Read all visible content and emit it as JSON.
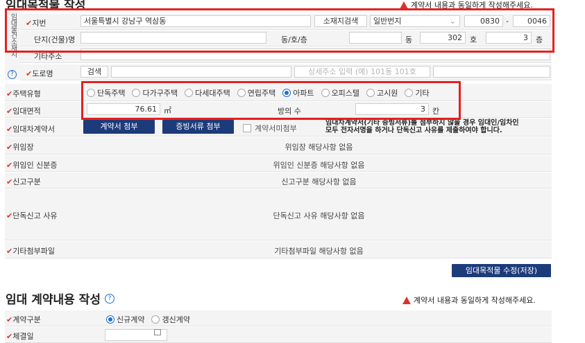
{
  "section1": {
    "title": "임대목적물 작성",
    "warning": "계약서 내용과 동일하게 작성해주세요."
  },
  "location": {
    "side_label": "임대물건소재지",
    "lot": {
      "label": "지번",
      "address": "서울특별시 강남구 역삼동",
      "search_button": "소재지검색",
      "type_select": "일반번지",
      "main_no": "0830",
      "sep": "-",
      "sub_no": "0046"
    },
    "complex": {
      "label": "단지(건물)명",
      "value": "",
      "dong_ho_label": "동/호/층",
      "dong_value": "",
      "dong_unit": "동",
      "ho_value": "302",
      "ho_unit": "호",
      "floor_value": "3",
      "floor_unit": "층"
    },
    "other_address": {
      "label": "기타주소",
      "value": ""
    },
    "road": {
      "label": "도로명",
      "search_button": "검색",
      "value": "",
      "detail_placeholder": "상세주소 입력 (예) 101동 101호",
      "extra": ""
    }
  },
  "housing_type": {
    "label": "주택유형",
    "options": [
      "단독주택",
      "다가구주택",
      "다세대주택",
      "연립주택",
      "아파트",
      "오피스텔",
      "고시원",
      "기타"
    ],
    "selected_index": 4
  },
  "lease_area": {
    "label": "임대면적",
    "value": "76.61",
    "unit": "㎡",
    "rooms_label": "방의 수",
    "rooms_value": "3",
    "rooms_unit": "칸"
  },
  "contract": {
    "label": "임대차계약서",
    "attach_button": "계약서 첨부",
    "evidence_button": "증빙서류 첨부",
    "not_attached_label": "계약서미첨부",
    "notice_line1": "임대차계약서(기타 증빙서류)를 첨부하지 않을 경우 임대인/임차인",
    "notice_line2": "모두 전자서명을 하거나 단독신고 사유를 제출하여야 합니다."
  },
  "power_of_attorney": {
    "label": "위임장",
    "value": "위임장 해당사항 없음"
  },
  "delegate_id": {
    "label": "위임인 신분증",
    "value": "위임인 신분증 해당사항 없음"
  },
  "report_type": {
    "label": "신고구분",
    "value": "신고구분 해당사항 없음"
  },
  "sole_report": {
    "label": "단독신고 사유",
    "value": "단독신고 사유 해당사항 없음"
  },
  "other_attachment": {
    "label": "기타첨부파일",
    "value": "기타첨부파일 해당사항 없음"
  },
  "save_button": "임대목적물 수정(저장)",
  "section2": {
    "title": "임대 계약내용 작성",
    "warning": "계약서 내용과 동일하게 작성해주세요."
  },
  "contract_type": {
    "label": "계약구분",
    "options": [
      "신규계약",
      "갱신계약"
    ],
    "selected_index": 0
  },
  "contract_date": {
    "label": "체결일",
    "value": ""
  },
  "colors": {
    "accent_red": "#e5201f",
    "navy": "#1d3b7a",
    "radio_blue": "#1f6fd1"
  }
}
